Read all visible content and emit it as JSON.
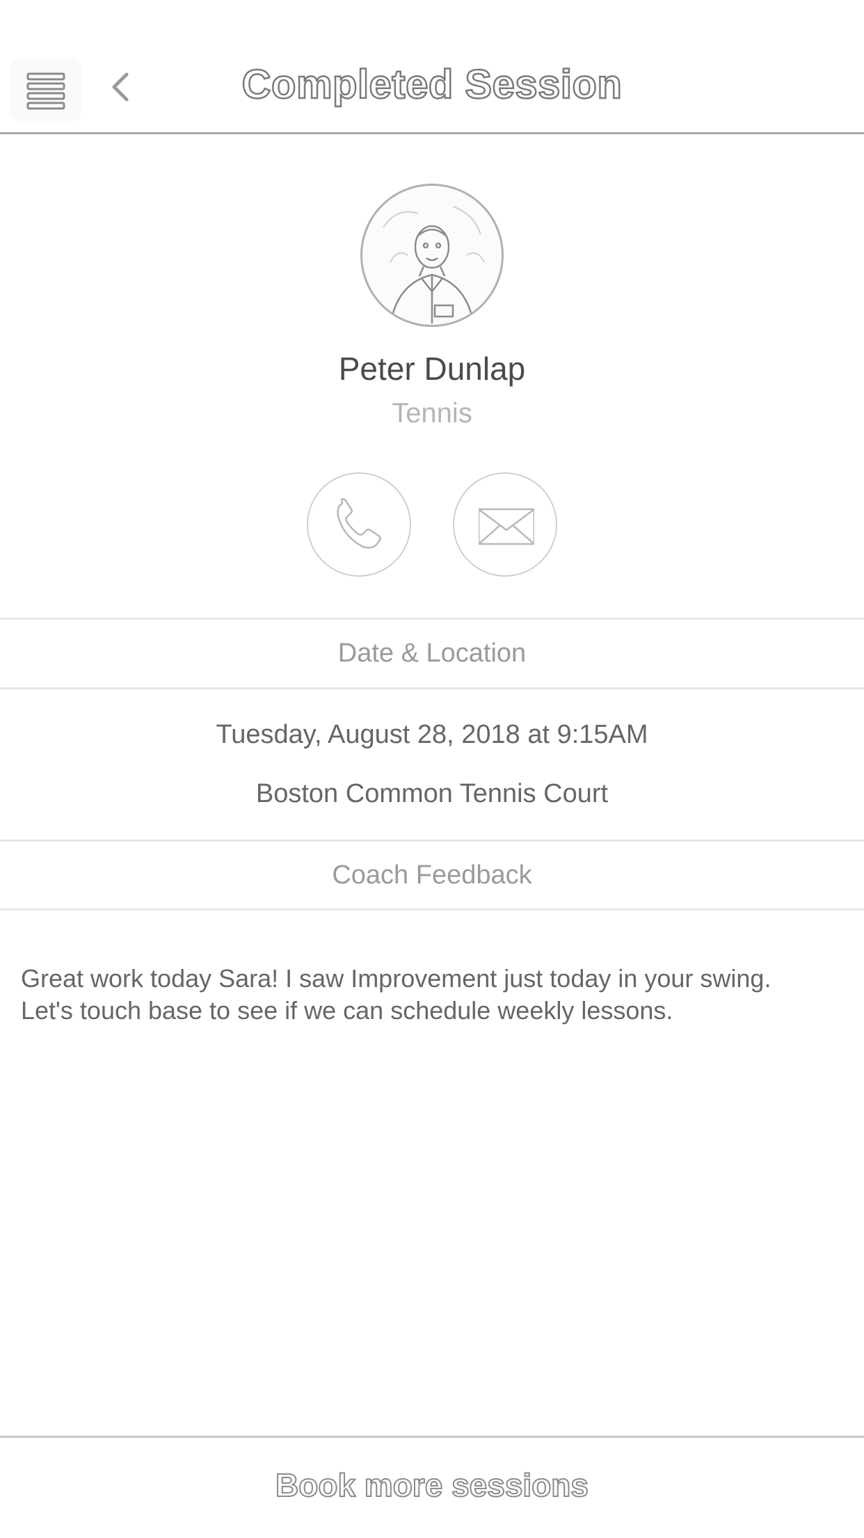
{
  "header": {
    "title": "Completed Session",
    "menu_icon": "hamburger-menu-icon",
    "back_icon": "chevron-left-icon"
  },
  "coach": {
    "name": "Peter Dunlap",
    "sport": "Tennis",
    "avatar_icon": "coach-photo"
  },
  "contact": {
    "phone_icon": "phone-icon",
    "email_icon": "envelope-icon"
  },
  "date_location": {
    "title": "Date & Location",
    "datetime": "Tuesday, August 28, 2018 at 9:15AM",
    "location": "Boston Common Tennis Court"
  },
  "feedback": {
    "title": "Coach Feedback",
    "text": "Great work today Sara! I saw Improvement just today in your swing. Let's touch base to see if we can schedule weekly lessons."
  },
  "footer": {
    "book_label": "Book more sessions"
  },
  "colors": {
    "background": "#ffffff",
    "divider": "#e6e6e6",
    "text": "#555555",
    "muted": "#b5b5b5"
  }
}
